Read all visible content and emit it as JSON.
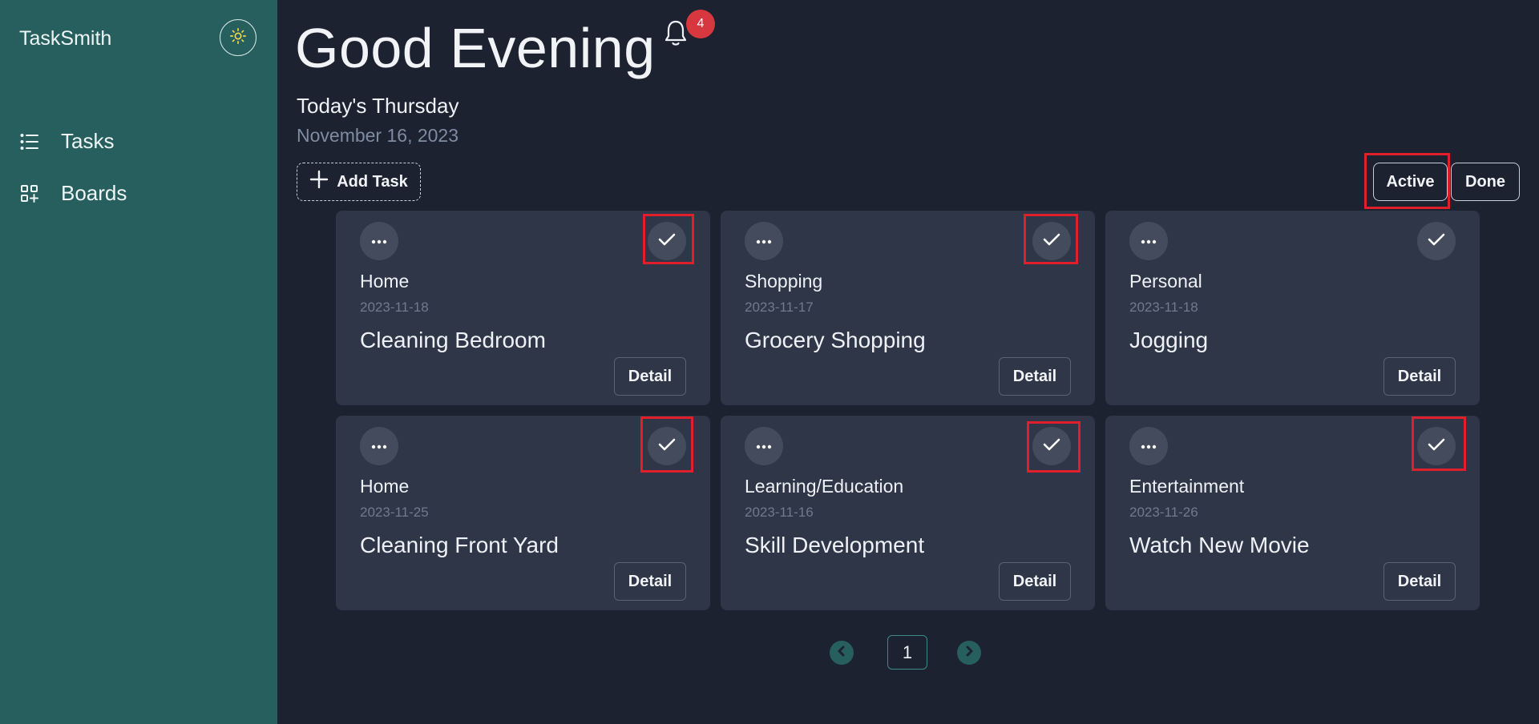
{
  "app": {
    "brand": "TaskSmith"
  },
  "sidebar": {
    "items": [
      {
        "label": "Tasks",
        "icon": "list-icon"
      },
      {
        "label": "Boards",
        "icon": "boards-icon"
      }
    ],
    "theme_icon": "sun-icon"
  },
  "header": {
    "greeting": "Good Evening",
    "notification_count": "4",
    "day": "Today's Thursday",
    "date": "November 16, 2023"
  },
  "toolbar": {
    "add_task_label": "Add Task",
    "filters": {
      "active": "Active",
      "done": "Done"
    }
  },
  "tasks": [
    {
      "category": "Home",
      "date": "2023-11-18",
      "title": "Cleaning Bedroom",
      "detail_label": "Detail"
    },
    {
      "category": "Shopping",
      "date": "2023-11-17",
      "title": "Grocery Shopping",
      "detail_label": "Detail"
    },
    {
      "category": "Personal",
      "date": "2023-11-18",
      "title": "Jogging",
      "detail_label": "Detail"
    },
    {
      "category": "Home",
      "date": "2023-11-25",
      "title": "Cleaning Front Yard",
      "detail_label": "Detail"
    },
    {
      "category": "Learning/Education",
      "date": "2023-11-16",
      "title": "Skill Development",
      "detail_label": "Detail"
    },
    {
      "category": "Entertainment",
      "date": "2023-11-26",
      "title": "Watch New Movie",
      "detail_label": "Detail"
    }
  ],
  "pagination": {
    "current_page": "1"
  },
  "colors": {
    "sidebar_bg": "#275e5e",
    "main_bg": "#1d2230",
    "card_bg": "#2f3647",
    "badge": "#d7373f",
    "highlight": "#e01f2a"
  }
}
